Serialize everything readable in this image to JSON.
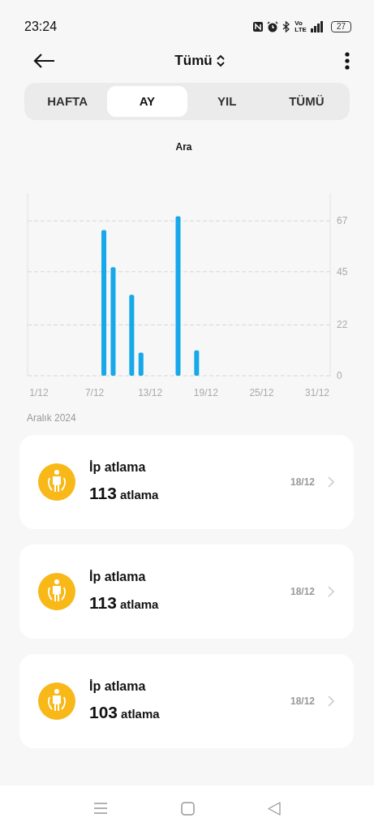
{
  "status_bar": {
    "time": "23:24",
    "volte": [
      "Vo",
      "LTE"
    ],
    "battery": "27"
  },
  "header": {
    "title": "Tümü"
  },
  "tabs": [
    {
      "label": "HAFTA",
      "selected": false
    },
    {
      "label": "AY",
      "selected": true
    },
    {
      "label": "YIL",
      "selected": false
    },
    {
      "label": "TÜMÜ",
      "selected": false
    }
  ],
  "chart": {
    "chart_data": {
      "type": "bar",
      "title": "Ara",
      "categories": [
        "1/12",
        null,
        null,
        null,
        null,
        null,
        "7/12",
        null,
        null,
        null,
        null,
        null,
        "13/12",
        null,
        null,
        null,
        null,
        null,
        "19/12",
        null,
        null,
        null,
        null,
        null,
        "25/12",
        null,
        null,
        null,
        null,
        null,
        "31/12"
      ],
      "series": [
        {
          "color": "#16a8e8",
          "values": [
            null,
            null,
            null,
            null,
            null,
            null,
            null,
            63,
            47,
            null,
            35,
            10,
            null,
            null,
            null,
            69,
            null,
            11,
            null,
            null,
            null,
            null,
            null,
            null,
            null,
            null,
            null,
            null,
            null,
            null,
            null
          ]
        }
      ],
      "ylim": [
        0,
        79
      ],
      "grid": true,
      "yticks": [
        0,
        22,
        45,
        67
      ]
    }
  },
  "section_title": "Aralık 2024",
  "records": [
    {
      "title": "İp atlama",
      "count": "113",
      "unit": "atlama",
      "date": "18/12"
    },
    {
      "title": "İp atlama",
      "count": "113",
      "unit": "atlama",
      "date": "18/12"
    },
    {
      "title": "İp atlama",
      "count": "103",
      "unit": "atlama",
      "date": "18/12"
    }
  ]
}
